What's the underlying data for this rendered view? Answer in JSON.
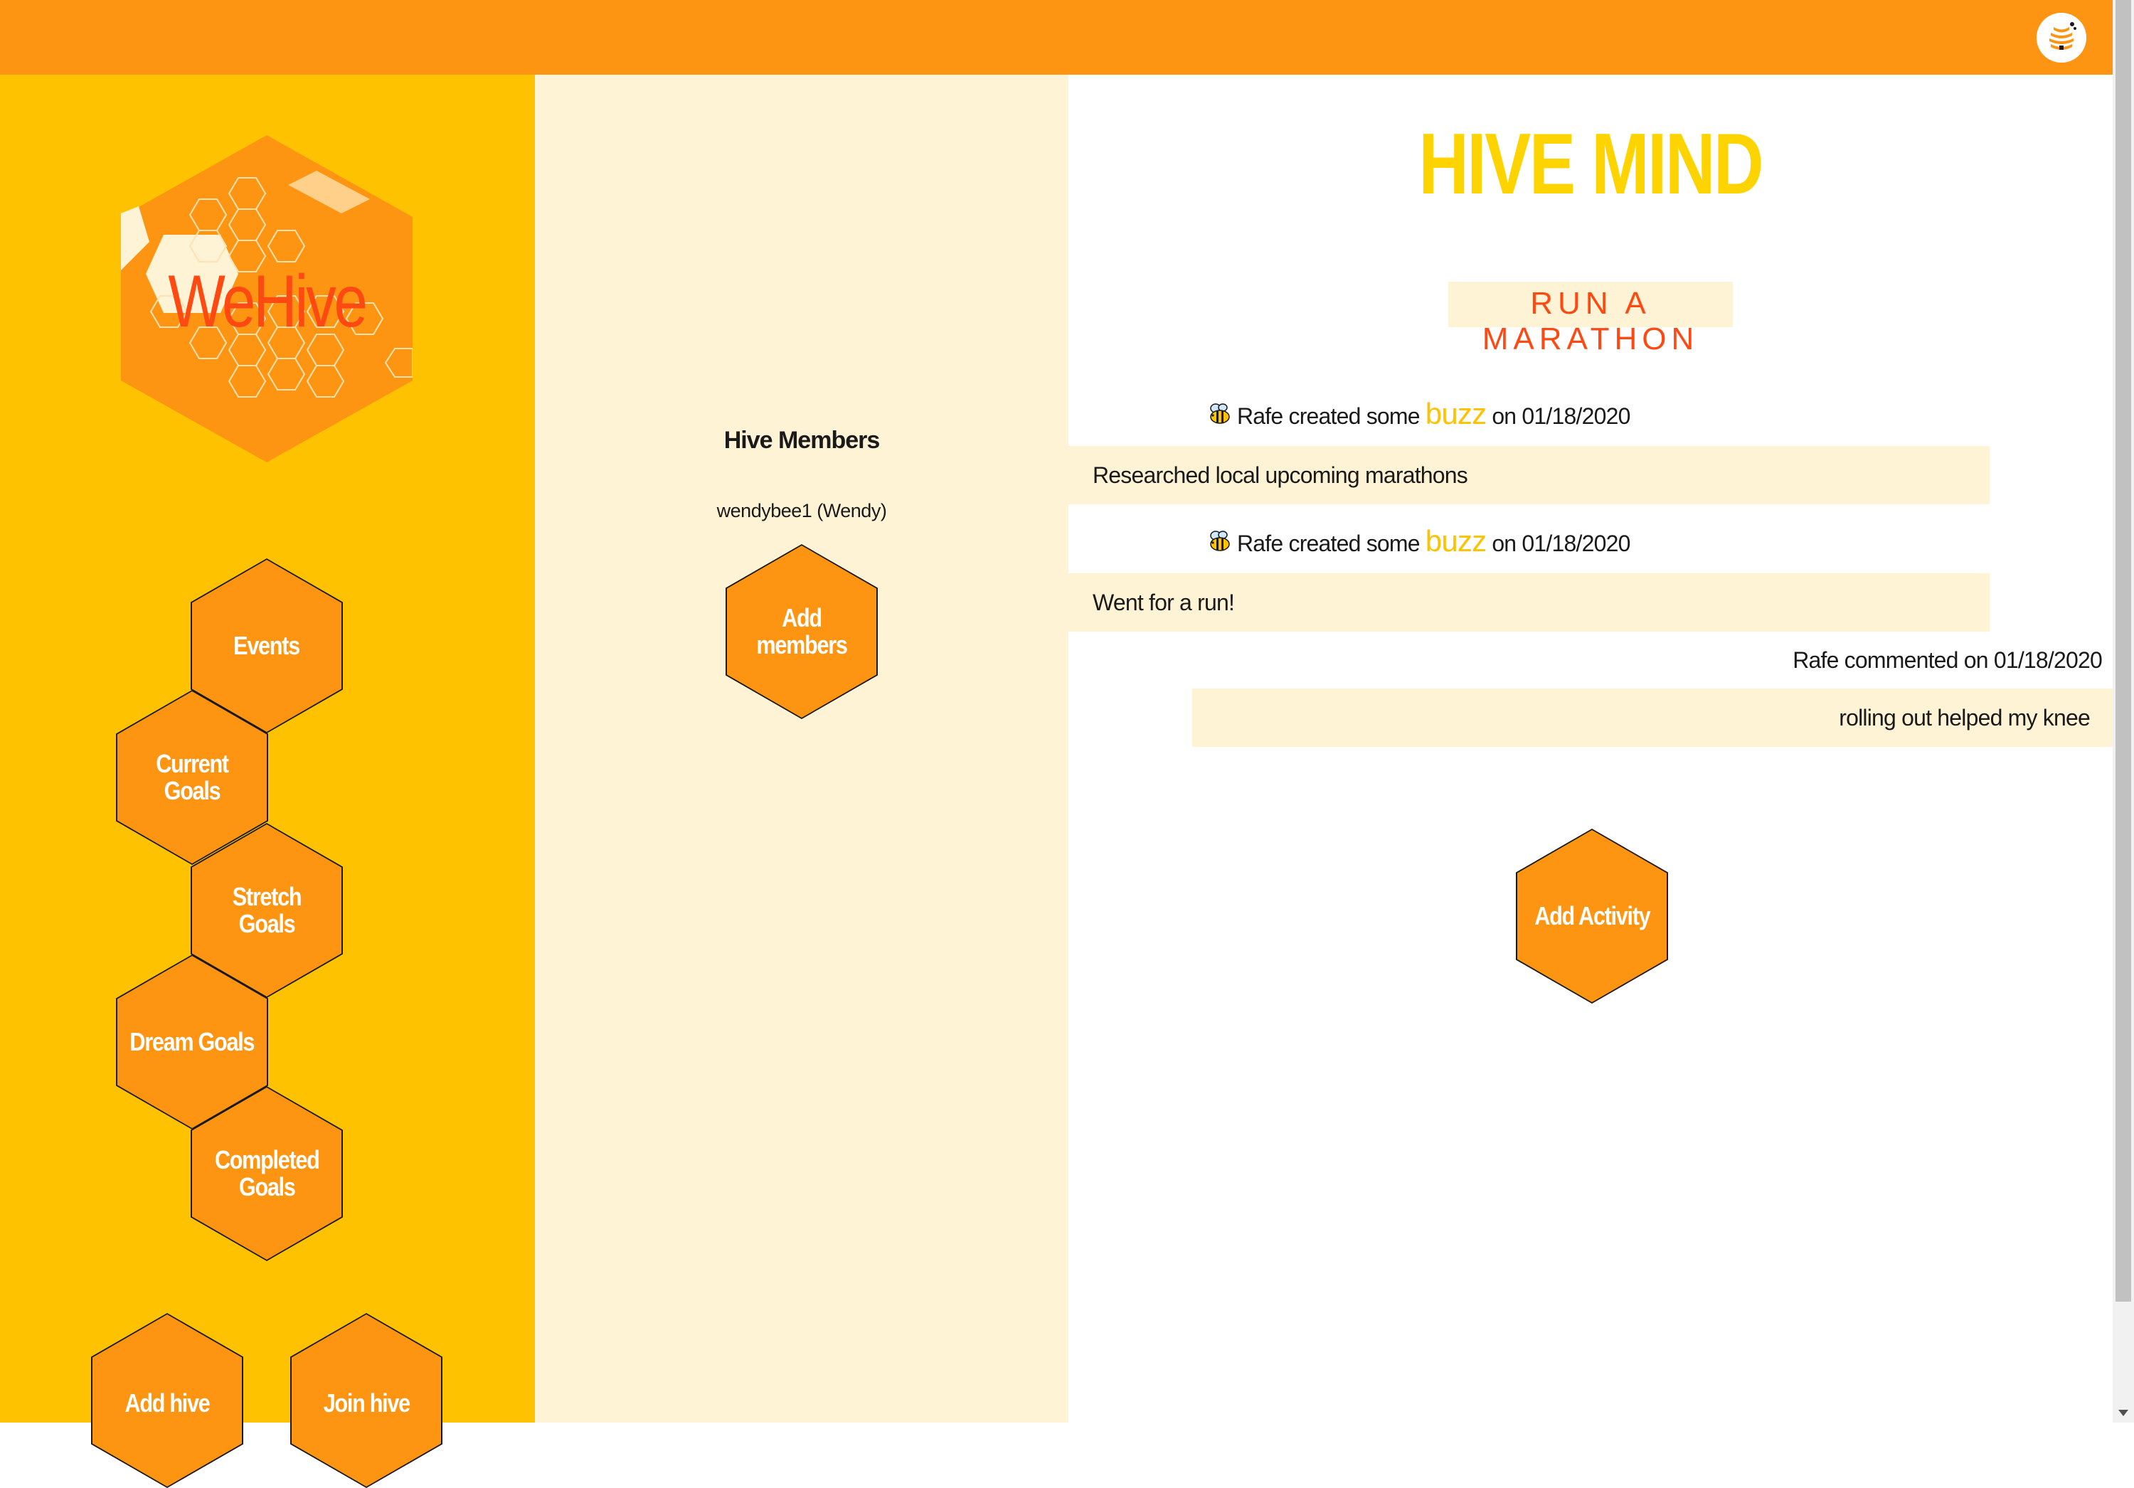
{
  "header": {
    "user_avatar_icon": "beehive-icon",
    "bar_color": "#fe9512"
  },
  "sidebar": {
    "logo_text": "WeHive",
    "nav": [
      {
        "label": "Events"
      },
      {
        "label": "Current Goals"
      },
      {
        "label": "Stretch Goals"
      },
      {
        "label": "Dream Goals"
      },
      {
        "label": "Completed Goals"
      }
    ],
    "add_hive_label": "Add hive",
    "join_hive_label": "Join hive",
    "background": "#fec200"
  },
  "members": {
    "title": "Hive Members",
    "items": [
      "wendybee1 (Wendy)"
    ],
    "add_label": "Add members"
  },
  "main": {
    "title": "HIVE MIND",
    "goal": "RUN A MARATHON",
    "activities": [
      {
        "author": "Rafe",
        "prefix": "created some",
        "buzz_word": "buzz",
        "on_text": "on",
        "date": "01/18/2020",
        "text": "Researched local upcoming marathons",
        "icon": "bee-icon"
      },
      {
        "author": "Rafe",
        "prefix": "created some",
        "buzz_word": "buzz",
        "on_text": "on",
        "date": "01/18/2020",
        "text": "Went for a run!",
        "icon": "bee-icon"
      }
    ],
    "comment": {
      "header": "Rafe commented on 01/18/2020",
      "text": "rolling out helped my knee"
    },
    "add_activity_label": "Add Activity"
  },
  "colors": {
    "orange": "#fe9512",
    "yellow": "#fec200",
    "cream": "#fff3d6",
    "title_yellow": "#fed400",
    "accent_red": "#fe4a12"
  }
}
